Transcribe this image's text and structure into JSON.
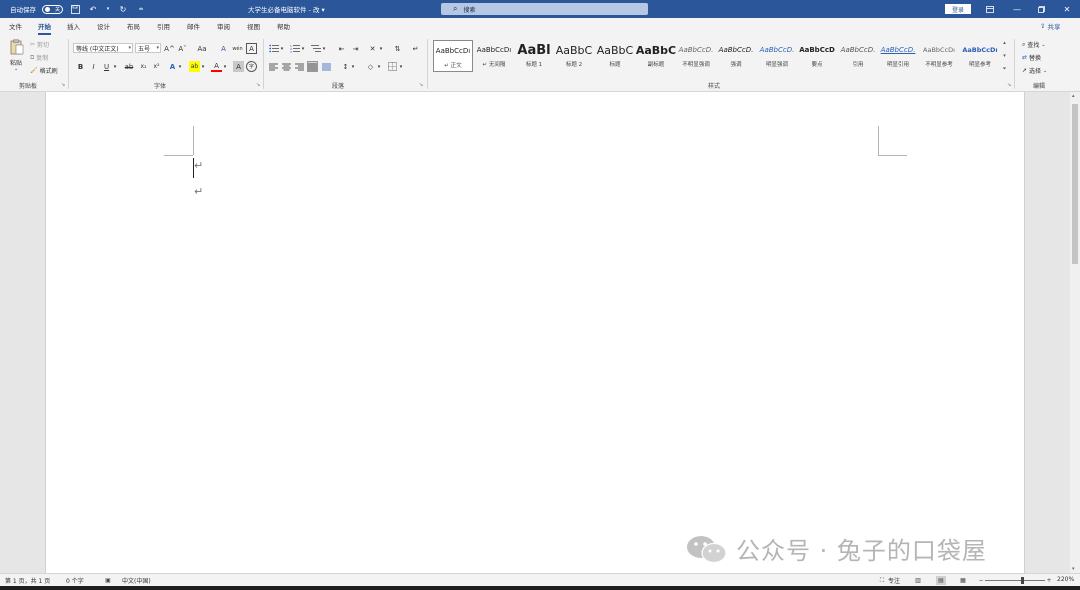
{
  "titlebar": {
    "autosave_label": "自动保存",
    "autosave_state": "关",
    "doc_title": "大学生必备电脑软件 - 改 ▾",
    "search_placeholder": "搜索",
    "login_label": "登录"
  },
  "tabs": [
    "文件",
    "开始",
    "插入",
    "设计",
    "布局",
    "引用",
    "邮件",
    "审阅",
    "视图",
    "帮助"
  ],
  "share_label": "共享",
  "clipboard": {
    "paste": "粘贴",
    "cut": "剪切",
    "copy": "复制",
    "format_painter": "格式刷",
    "group_label": "剪贴板"
  },
  "font": {
    "font_name": "等线 (中文正文)",
    "font_size": "五号",
    "group_label": "字体",
    "bold": "B",
    "italic": "I",
    "underline": "U",
    "strike": "ab",
    "subscript": "x₂",
    "superscript": "x²",
    "grow": "A^",
    "shrink": "Aˇ",
    "case": "Aa",
    "clear": "A",
    "phonetic": "wén",
    "border_char": "A",
    "effects": "A",
    "highlight": "ab",
    "font_color": "A",
    "shade_char": "A",
    "enclose": "字"
  },
  "paragraph": {
    "group_label": "段落"
  },
  "styles": {
    "group_label": "样式",
    "items": [
      {
        "preview": "AaBbCcDı",
        "name": "↵ 正文",
        "selected": true
      },
      {
        "preview": "AaBbCcDı",
        "name": "↵ 无间隔",
        "selected": false
      },
      {
        "preview": "AaBl",
        "name": "标题 1",
        "selected": false
      },
      {
        "preview": "AaBbC",
        "name": "标题 2",
        "selected": false
      },
      {
        "preview": "AaBbC",
        "name": "标题",
        "selected": false
      },
      {
        "preview": "AaBbC",
        "name": "副标题",
        "selected": false
      },
      {
        "preview": "AaBbCcD.",
        "name": "不明显强调",
        "selected": false
      },
      {
        "preview": "AaBbCcD.",
        "name": "强调",
        "selected": false
      },
      {
        "preview": "AaBbCcD.",
        "name": "明显强调",
        "selected": false
      },
      {
        "preview": "AaBbCcD",
        "name": "要点",
        "selected": false
      },
      {
        "preview": "AaBbCcD.",
        "name": "引用",
        "selected": false
      },
      {
        "preview": "AaBbCcD.",
        "name": "明显引用",
        "selected": false
      },
      {
        "preview": "AaBbCcDı",
        "name": "不明显参考",
        "selected": false
      },
      {
        "preview": "AaBbCcDı",
        "name": "明显参考",
        "selected": false
      }
    ]
  },
  "editing": {
    "find": "查找",
    "replace": "替换",
    "select": "选择",
    "group_label": "编辑"
  },
  "document": {
    "para_mark": "↵"
  },
  "watermark": {
    "text": "公众号 · 兔子的口袋屋"
  },
  "statusbar": {
    "page": "第 1 页，共 1 页",
    "words": "0 个字",
    "language": "中文(中国)",
    "focus": "专注",
    "zoom": "220%"
  },
  "colors": {
    "brand": "#2b579a",
    "highlight": "#ffff00",
    "font_color": "#ff0000"
  }
}
